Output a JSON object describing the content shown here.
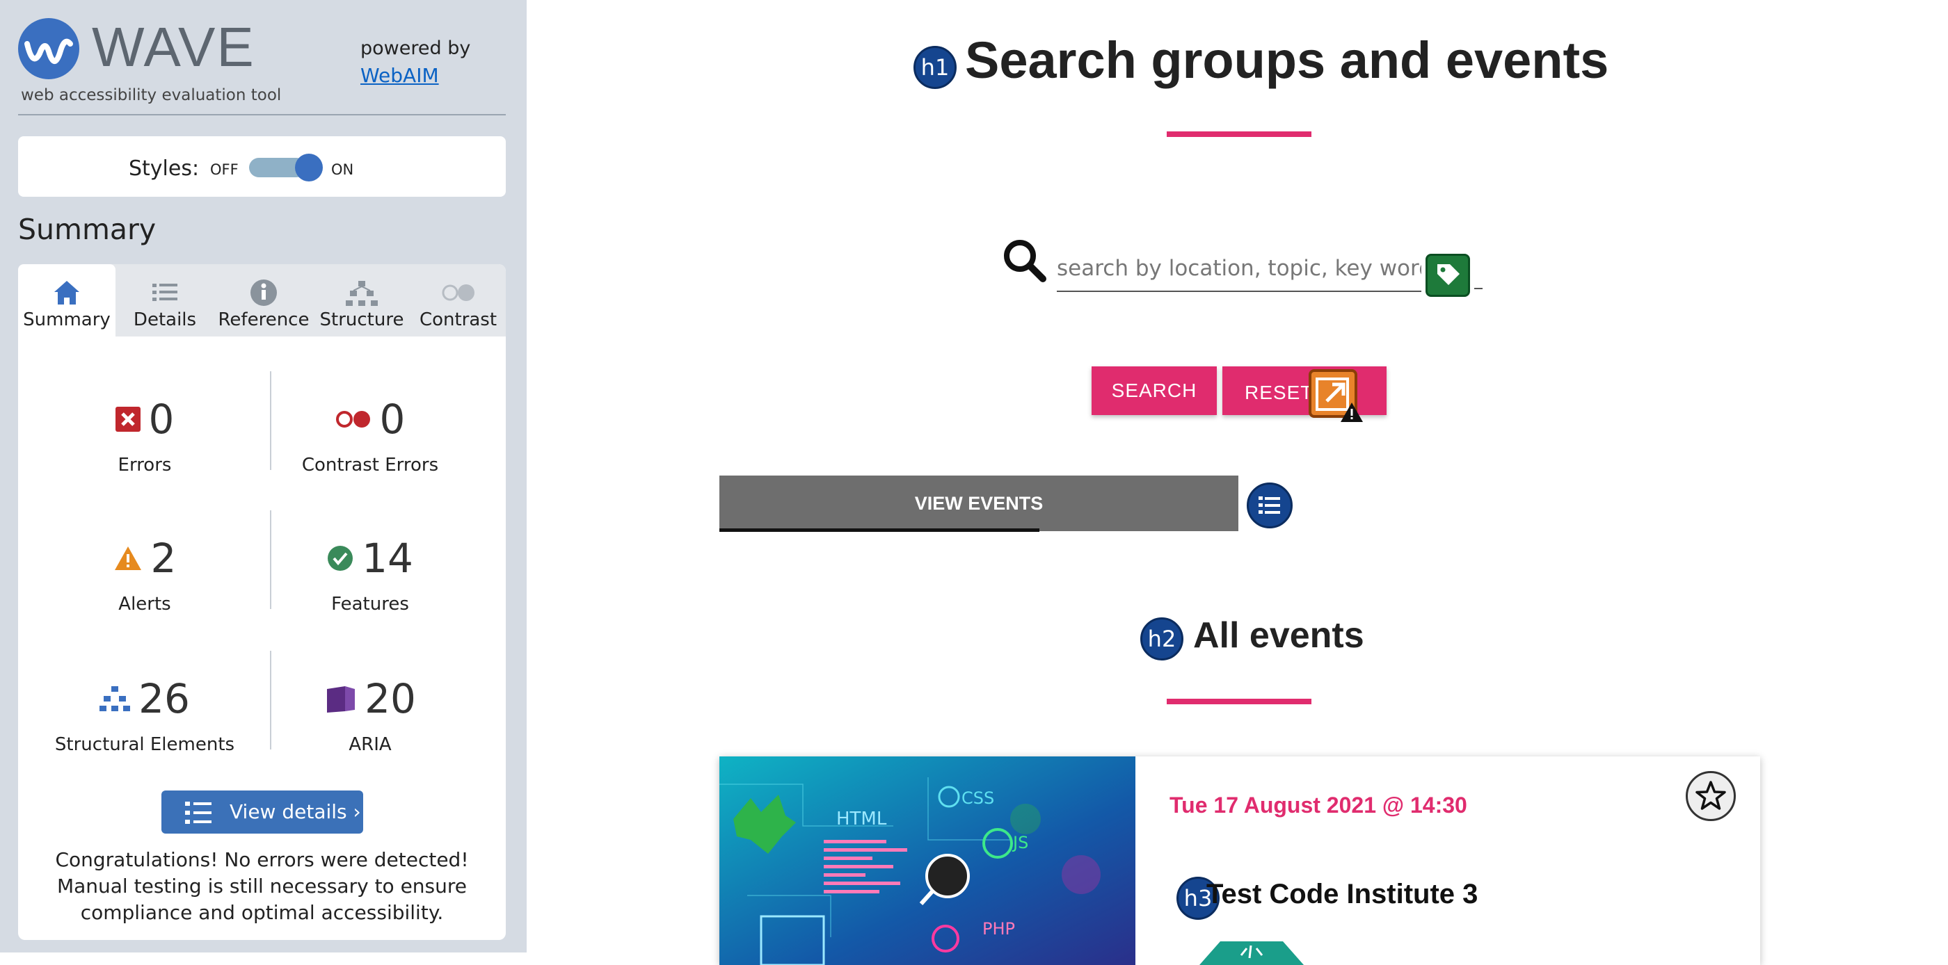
{
  "wave": {
    "logo_word": "WAVE",
    "tagline": "web accessibility evaluation tool",
    "powered_by": "powered by",
    "webaim_link": "WebAIM",
    "styles_label": "Styles:",
    "off_label": "OFF",
    "on_label": "ON",
    "styles_on": true,
    "summary_title": "Summary",
    "tabs": [
      {
        "label": "Summary",
        "icon": "home-icon",
        "active": true
      },
      {
        "label": "Details",
        "icon": "list-icon",
        "active": false
      },
      {
        "label": "Reference",
        "icon": "info-icon",
        "active": false
      },
      {
        "label": "Structure",
        "icon": "structure-icon",
        "active": false
      },
      {
        "label": "Contrast",
        "icon": "contrast-icon",
        "active": false
      }
    ],
    "stats": {
      "errors": {
        "value": "0",
        "label": "Errors",
        "icon": "error-icon"
      },
      "contrast_errors": {
        "value": "0",
        "label": "Contrast Errors",
        "icon": "contrast-error-icon"
      },
      "alerts": {
        "value": "2",
        "label": "Alerts",
        "icon": "alert-icon"
      },
      "features": {
        "value": "14",
        "label": "Features",
        "icon": "feature-icon"
      },
      "structural": {
        "value": "26",
        "label": "Structural Elements",
        "icon": "structure-icon"
      },
      "aria": {
        "value": "20",
        "label": "ARIA",
        "icon": "aria-icon"
      }
    },
    "view_details": "View details ›",
    "congrats": "Congratulations! No errors were detected! Manual testing is still necessary to ensure compliance and optimal accessibility.",
    "colors": {
      "sidebar_bg": "#d5dbe3",
      "accent": "#3b71b8",
      "error": "#c0272d",
      "alert": "#e68a1f",
      "feature": "#3a8a5a",
      "aria": "#5b2c83"
    }
  },
  "page": {
    "h1_badge": "h1",
    "h1": "Search groups and events",
    "search_placeholder": "search by location, topic, key words...",
    "search_button": "SEARCH",
    "reset_button": "RESET",
    "view_events": "VIEW EVENTS",
    "h2_badge": "h2",
    "h2": "All events",
    "event": {
      "date": "Tue 17 August 2021 @ 14:30",
      "h3_badge": "h3",
      "title": "Test Code Institute 3",
      "image_labels": [
        "HTML",
        "CSS",
        "JS",
        "PHP"
      ]
    },
    "colors": {
      "brand": "#e02c6e",
      "heading_badge": "#15458f"
    }
  }
}
